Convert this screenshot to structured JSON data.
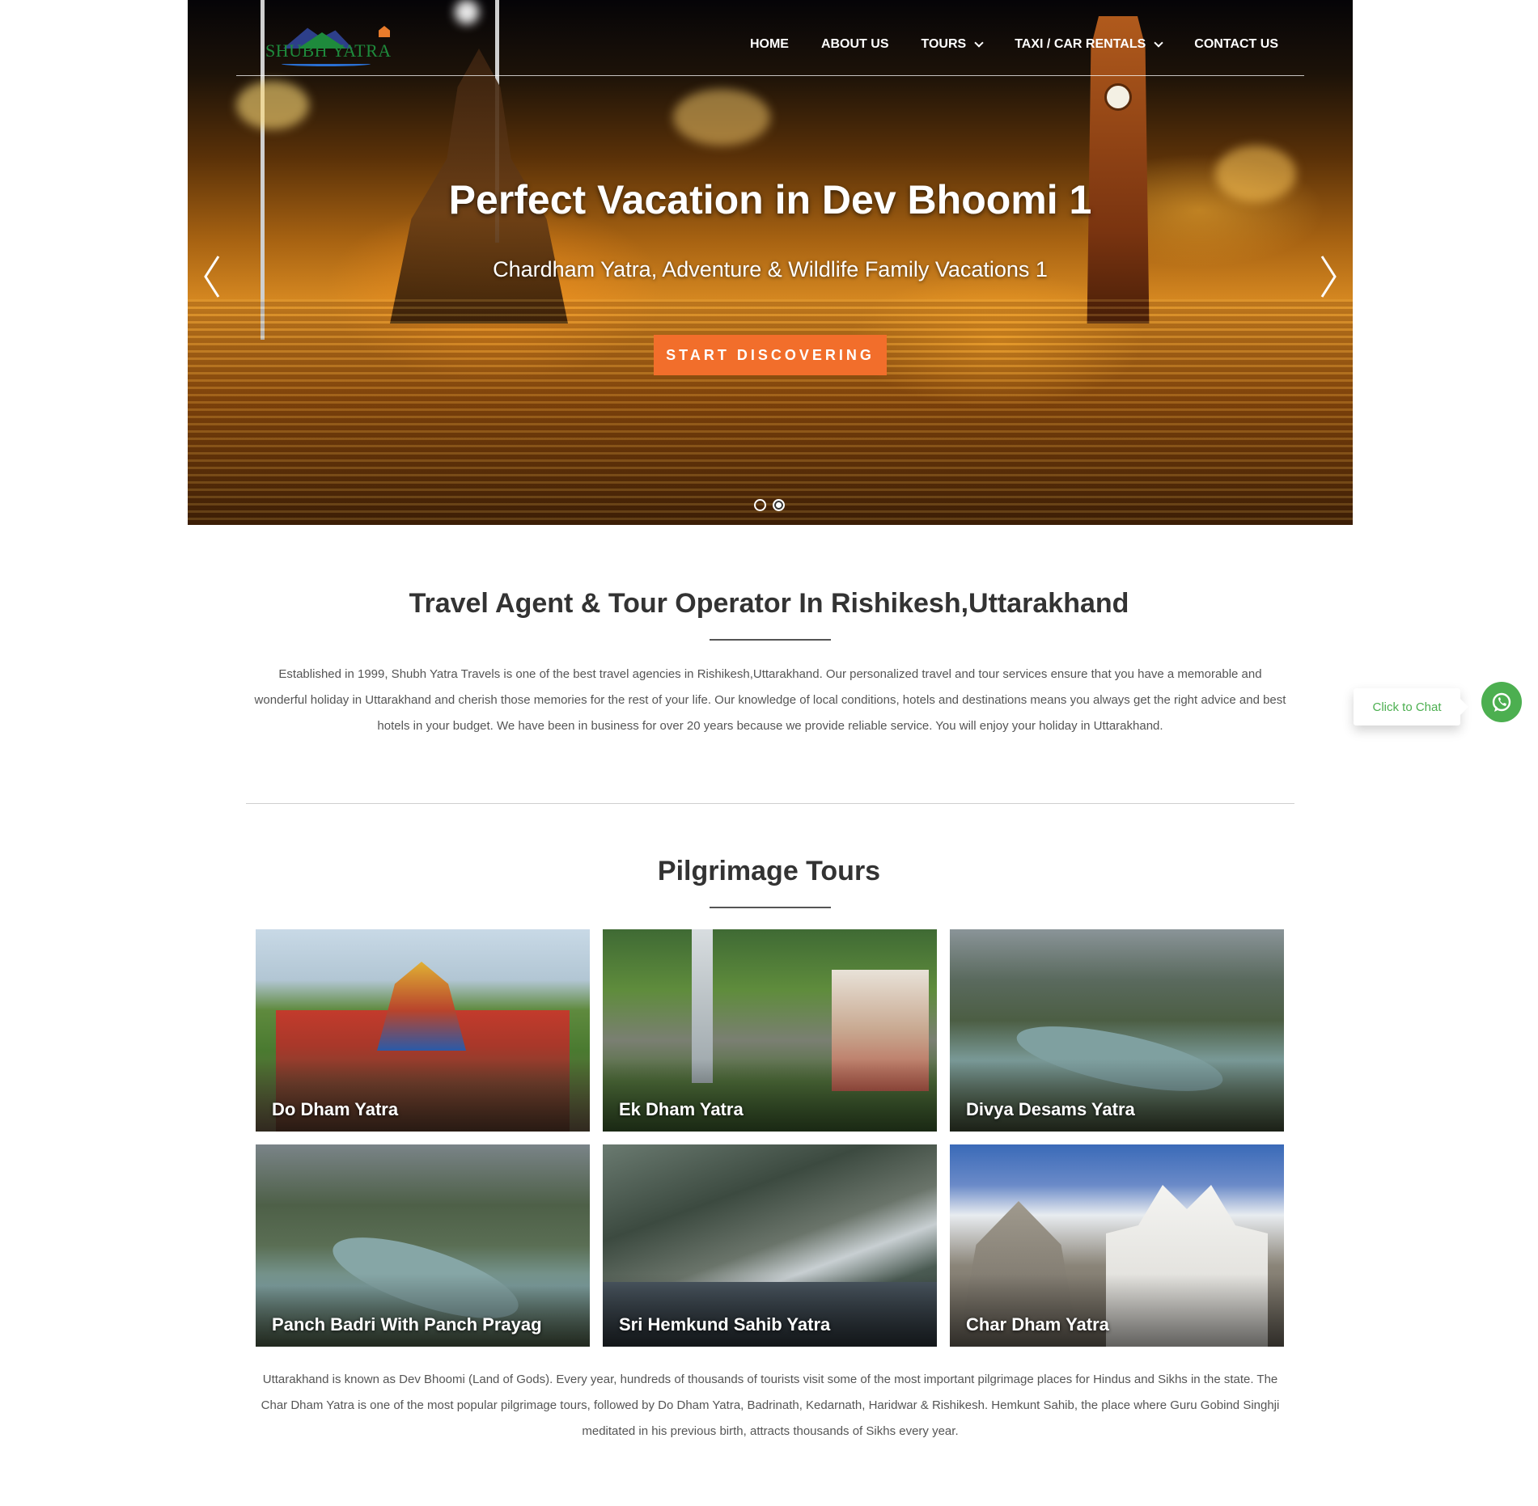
{
  "nav": {
    "logo_text": "SHUBH YATRA",
    "menu": [
      {
        "label": "HOME",
        "dropdown": false
      },
      {
        "label": "ABOUT US",
        "dropdown": false
      },
      {
        "label": "TOURS",
        "dropdown": true
      },
      {
        "label": "TAXI / CAR RENTALS",
        "dropdown": true
      },
      {
        "label": "CONTACT US",
        "dropdown": false
      }
    ]
  },
  "hero": {
    "title": "Perfect Vacation in Dev Bhoomi 1",
    "subtitle": "Chardham Yatra, Adventure & Wildlife Family Vacations 1",
    "cta": "START DISCOVERING",
    "slide_count": 2,
    "active_slide": 2
  },
  "intro": {
    "title": "Travel Agent & Tour Operator In Rishikesh,Uttarakhand",
    "body": "Established in 1999, Shubh Yatra Travels is one of the best travel agencies in Rishikesh,Uttarakhand. Our personalized travel and tour services ensure that you have a memorable and wonderful holiday in Uttarakhand and cherish those memories for the rest of your life. Our knowledge of local conditions, hotels and destinations means you always get the right advice and best hotels in your budget. We have been in business for over 20 years because we provide reliable service. You will enjoy your holiday in Uttarakhand."
  },
  "pilgrimage": {
    "title": "Pilgrimage Tours",
    "tours": [
      {
        "label": "Do Dham Yatra"
      },
      {
        "label": "Ek Dham Yatra"
      },
      {
        "label": "Divya Desams Yatra"
      },
      {
        "label": "Panch Badri With Panch Prayag"
      },
      {
        "label": "Sri Hemkund Sahib Yatra"
      },
      {
        "label": "Char Dham Yatra"
      }
    ],
    "body": "Uttarakhand is known as Dev Bhoomi (Land of Gods). Every year, hundreds of thousands of tourists visit some of the most important pilgrimage places for Hindus and Sikhs in the state. The Char Dham Yatra is one of the most popular pilgrimage tours, followed by Do Dham Yatra, Badrinath, Kedarnath, Haridwar & Rishikesh. Hemkunt Sahib, the place where Guru Gobind Singhji meditated in his previous birth, attracts thousands of Sikhs every year."
  },
  "chat": {
    "label": "Click to Chat",
    "icon": "whatsapp-icon",
    "color": "#4caf50"
  },
  "colors": {
    "accent": "#f26e2b",
    "logo_green": "#1e8a3c",
    "logo_blue": "#2d3f8a"
  }
}
